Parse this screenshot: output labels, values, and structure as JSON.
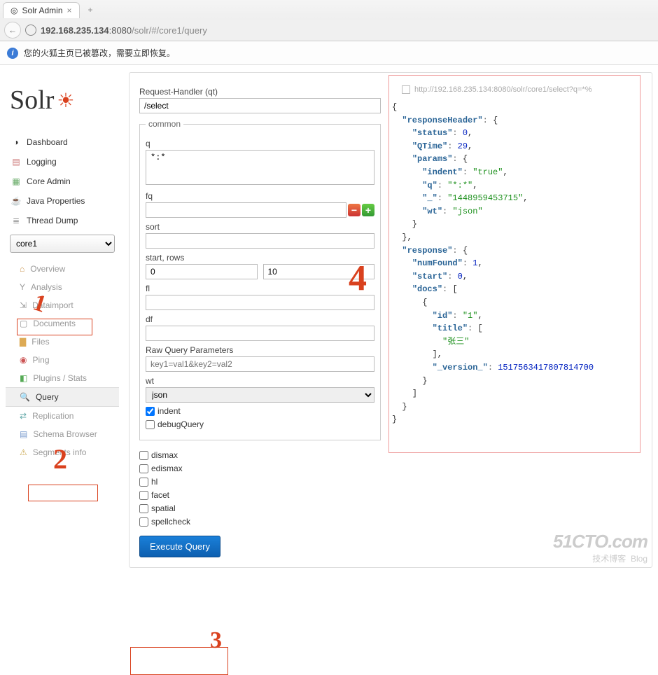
{
  "browser": {
    "tab_title": "Solr Admin",
    "url_host": "192.168.235.134",
    "url_port": ":8080",
    "url_path": "/solr/#/core1/query"
  },
  "notice": "您的火狐主页已被篡改，需要立即恢复。",
  "logo": "Solr",
  "nav": {
    "dashboard": "Dashboard",
    "logging": "Logging",
    "core_admin": "Core Admin",
    "java_properties": "Java Properties",
    "thread_dump": "Thread Dump"
  },
  "core_selected": "core1",
  "subnav": {
    "overview": "Overview",
    "analysis": "Analysis",
    "dataimport": "Dataimport",
    "documents": "Documents",
    "files": "Files",
    "ping": "Ping",
    "plugins": "Plugins / Stats",
    "query": "Query",
    "replication": "Replication",
    "schema": "Schema Browser",
    "segments": "Segments info"
  },
  "form": {
    "qt_label": "Request-Handler (qt)",
    "qt_value": "/select",
    "legend": "common",
    "q_label": "q",
    "q_value": "*:*",
    "fq_label": "fq",
    "fq_value": "",
    "sort_label": "sort",
    "sort_value": "",
    "start_label": "start, rows",
    "start_value": "0",
    "rows_value": "10",
    "fl_label": "fl",
    "fl_value": "",
    "df_label": "df",
    "df_value": "",
    "raw_label": "Raw Query Parameters",
    "raw_placeholder": "key1=val1&key2=val2",
    "wt_label": "wt",
    "wt_value": "json",
    "indent_label": "indent",
    "debug_label": "debugQuery",
    "dismax_label": "dismax",
    "edismax_label": "edismax",
    "hl_label": "hl",
    "facet_label": "facet",
    "spatial_label": "spatial",
    "spellcheck_label": "spellcheck",
    "exec": "Execute Query"
  },
  "result": {
    "url": "http://192.168.235.134:8080/solr/core1/select?q=*%",
    "json": {
      "responseHeader": {
        "status": 0,
        "QTime": 29,
        "params": {
          "indent": "true",
          "q": "*:*",
          "_": "1448959453715",
          "wt": "json"
        }
      },
      "response": {
        "numFound": 1,
        "start": 0,
        "docs": [
          {
            "id": "1",
            "title": [
              "张三"
            ],
            "_version_": 1517563417807814700
          }
        ]
      }
    }
  },
  "annotations": {
    "a1": "1",
    "a2": "2",
    "a3": "3",
    "a4": "4"
  },
  "watermark": {
    "line1": "51CTO.com",
    "line2": "技术博客",
    "line3": "Blog"
  }
}
